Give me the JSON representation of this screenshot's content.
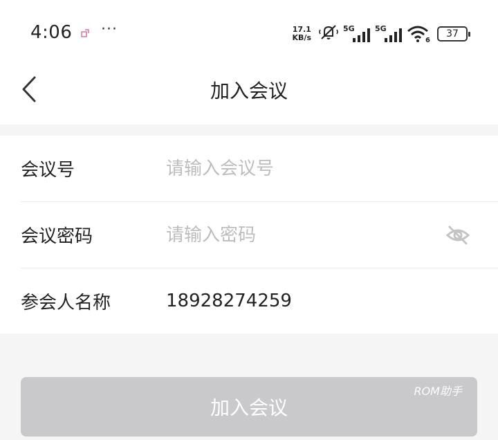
{
  "status_bar": {
    "time": "4:06",
    "net_speed_value": "17.1",
    "net_speed_unit": "KB/s",
    "sim1_label": "5G",
    "sim2_label": "5G",
    "wifi_badge": "6",
    "battery": "37",
    "more_glyph": "···",
    "icons": [
      "notification-icon",
      "mute-icon",
      "signal-icon",
      "wifi-icon",
      "battery-icon"
    ]
  },
  "header": {
    "title": "加入会议",
    "back_icon": "back-arrow-icon"
  },
  "form": {
    "meeting_id": {
      "label": "会议号",
      "value": "",
      "placeholder": "请输入会议号"
    },
    "password": {
      "label": "会议密码",
      "value": "",
      "placeholder": "请输入密码",
      "icon": "eye-hidden-icon"
    },
    "display_name": {
      "label": "参会人名称",
      "value": "18928274259",
      "placeholder": ""
    }
  },
  "actions": {
    "join_label": "加入会议"
  },
  "watermark": "ROM助手",
  "colors": {
    "button_disabled": "#c9c9cc",
    "placeholder": "#bdbdbd",
    "background": "#f5f5f5",
    "notification_accent": "#e06b8a"
  }
}
